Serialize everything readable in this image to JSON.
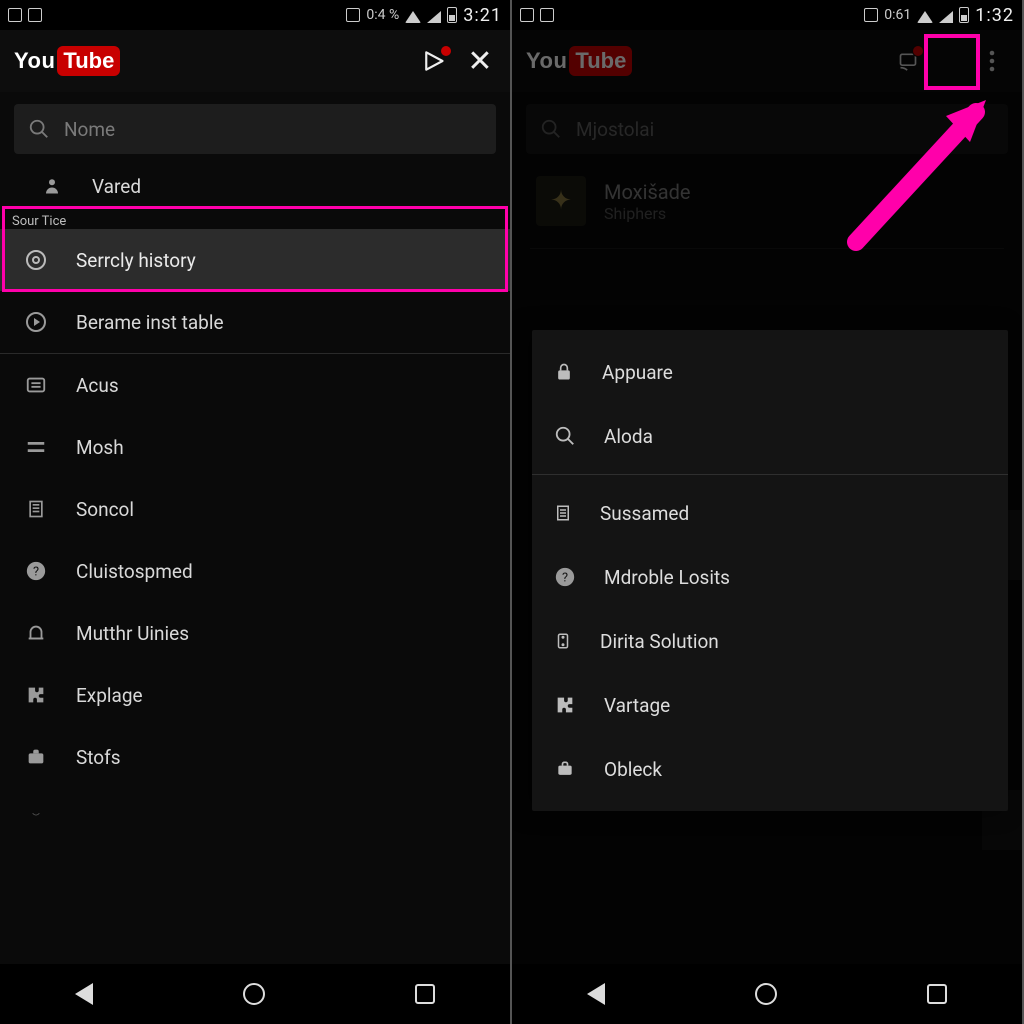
{
  "left": {
    "status": {
      "data": "0:4 %",
      "clock": "3:21"
    },
    "logo": {
      "you": "You",
      "tube": "Tube"
    },
    "search_placeholder": "Nome",
    "section_label": "Sour Tice",
    "top_item": "Vared",
    "highlight_item": "Serrcly history",
    "item_circle": "Berame inst table",
    "items": [
      "Acus",
      "Mosh",
      "Soncol",
      "Cluistospmed",
      "Mutthr Uinies",
      "Explage",
      "Stofs"
    ]
  },
  "right": {
    "status": {
      "data": "0:61",
      "clock": "1:32"
    },
    "logo": {
      "you": "You",
      "tube": "Tube"
    },
    "search_placeholder": "Mjostolai",
    "channel": {
      "title": "Moxišade",
      "subtitle": "Shiphers"
    },
    "popup_top": [
      "Appuare",
      "Aloda"
    ],
    "popup_bottom": [
      "Sussamed",
      "Mdroble Losits",
      "Dirita Solution",
      "Vartage",
      "Obleck"
    ]
  }
}
